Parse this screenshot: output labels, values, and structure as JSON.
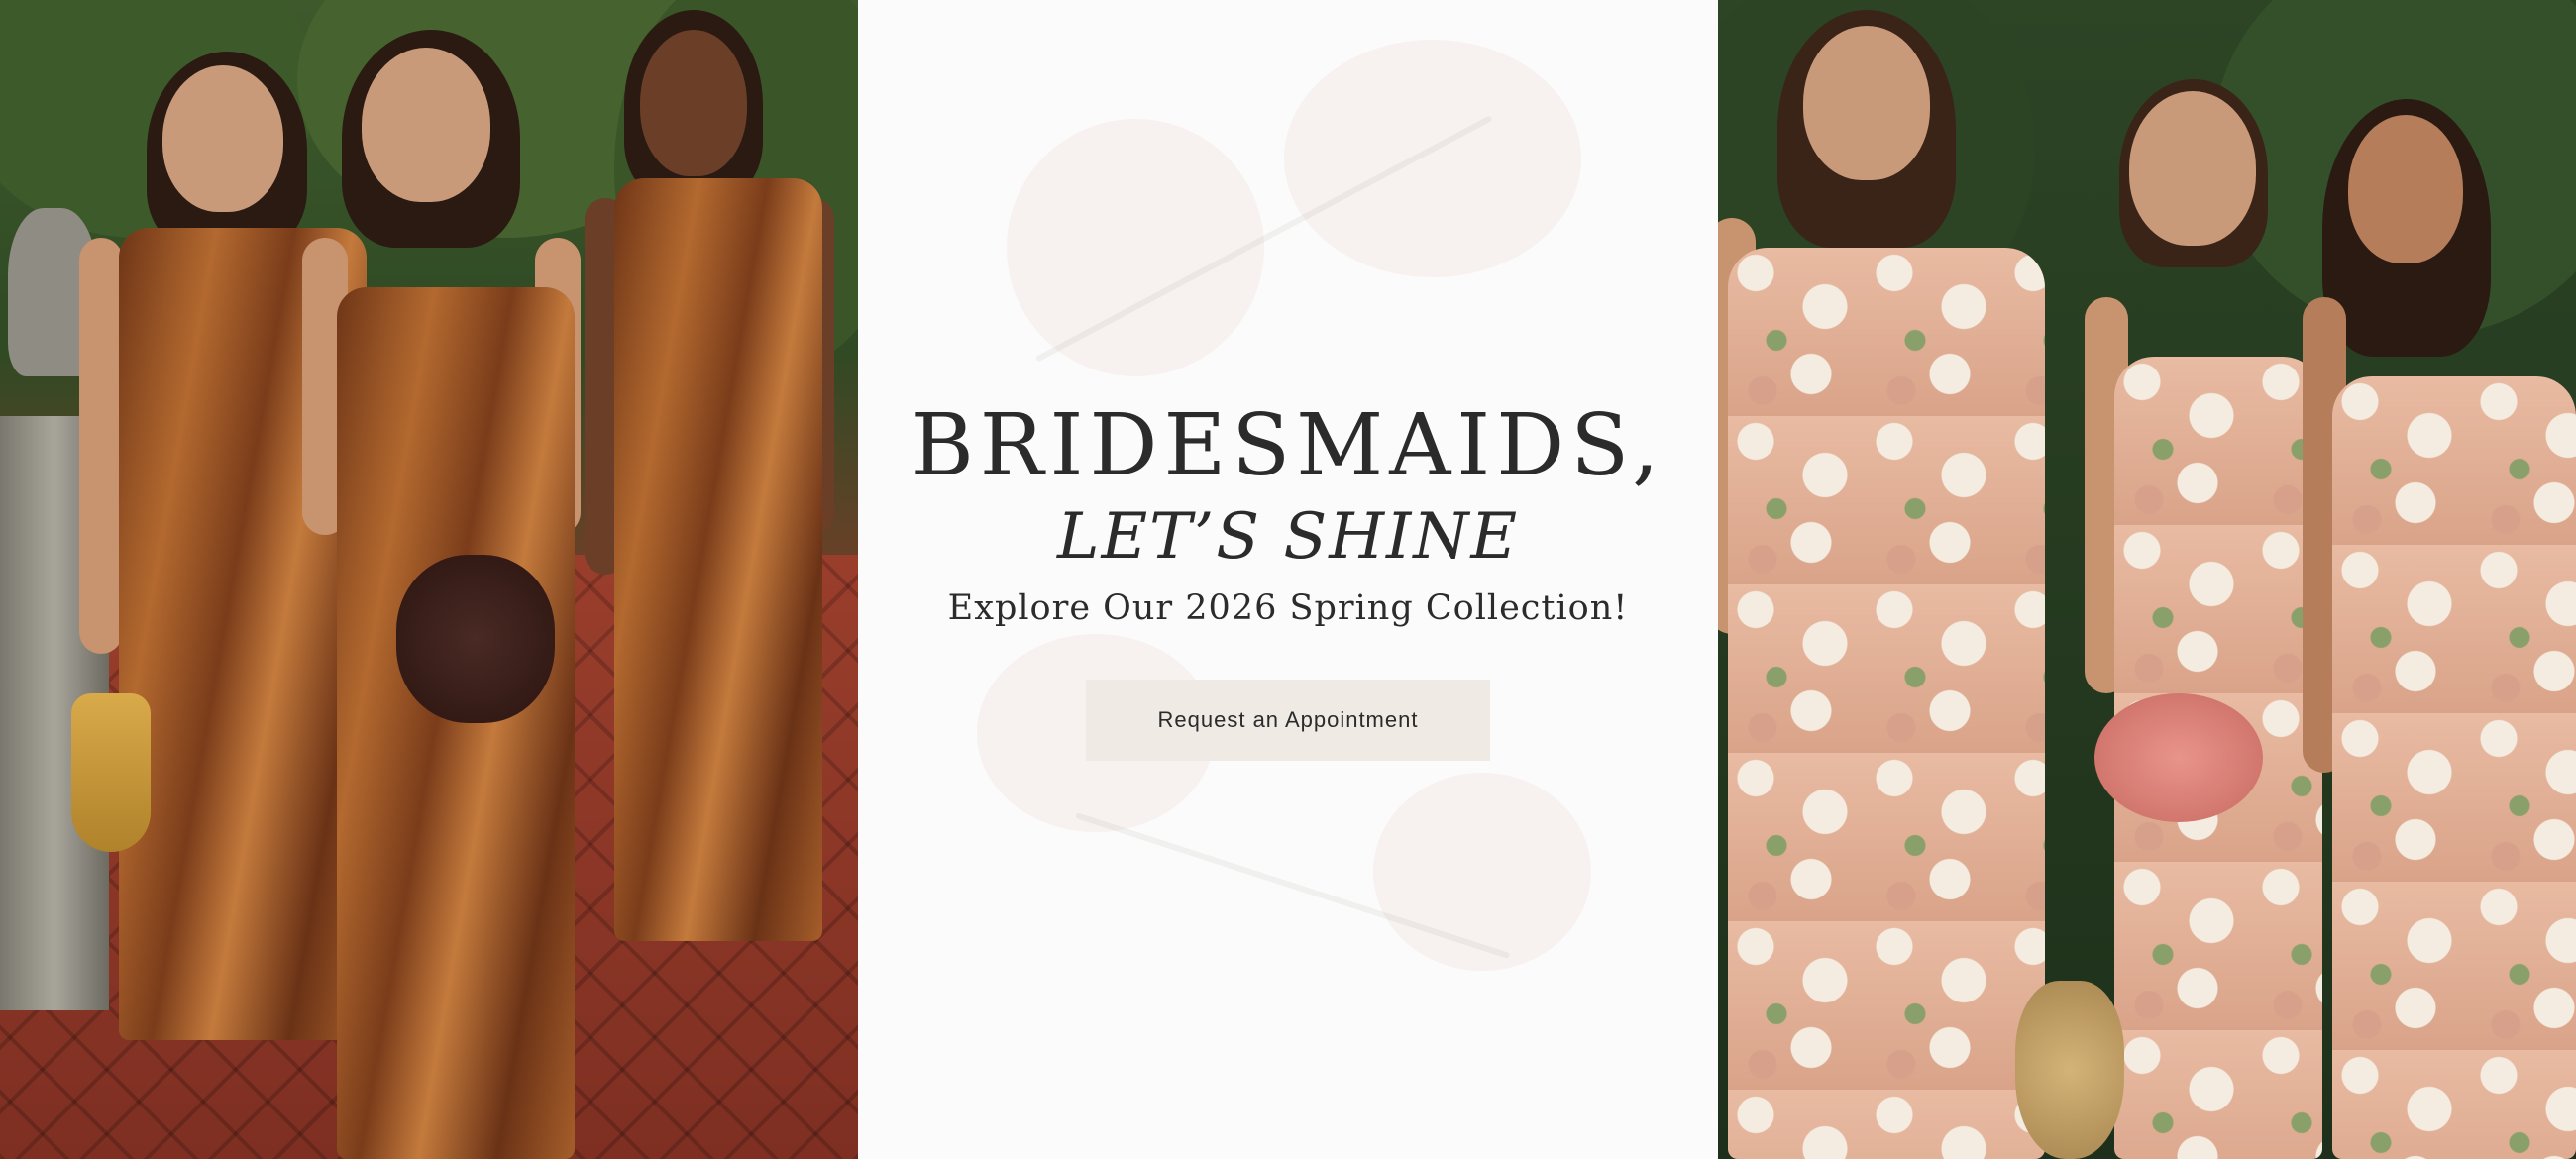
{
  "hero": {
    "headline": "BRIDESMAIDS,",
    "subhead_plain": "LET’S ",
    "subhead_emphasis": "SHINE",
    "tagline": "Explore Our 2026 Spring Collection!",
    "cta_label": "Request an Appointment"
  },
  "colors": {
    "cta_background": "#efebe4",
    "text": "#2b2b2b",
    "center_background": "#fbfbfb"
  },
  "images": {
    "left": "three-bridesmaids-in-copper-satin-dresses",
    "right": "three-bridesmaids-in-blush-floral-satin-dresses"
  }
}
